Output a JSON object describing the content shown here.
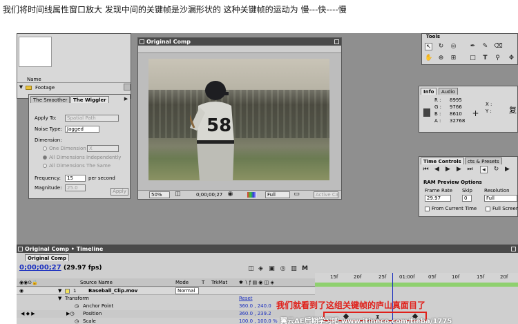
{
  "caption": "我们将时间线属性窗口放大 发现中间的关键帧是沙漏形状的 这种关键帧的运动为 慢---快----慢",
  "project": {
    "col_name": "Name",
    "folder": "Footage"
  },
  "effects": {
    "tab1": "The Smoother",
    "tab2": "The Wiggler",
    "apply_to_label": "Apply To:",
    "apply_to_value": "Spatial Path",
    "noise_label": "Noise Type:",
    "noise_value": "Jagged",
    "dimension_label": "Dimension:",
    "one_dim": "One Dimension",
    "one_dim_value": "X",
    "all_indep": "All Dimensions Independently",
    "all_same": "All Dimensions The Same",
    "freq_label": "Frequency:",
    "freq_value": "15",
    "freq_unit": "per second",
    "mag_label": "Magnitude:",
    "mag_value": "25.0",
    "apply_btn": "Apply"
  },
  "comp": {
    "title": "Original Comp",
    "tab": "Original Comp",
    "zoom": "50%",
    "timecode": "0;00;00;27",
    "quality": "Full",
    "camera": "Active Ca",
    "jersey_number": "58"
  },
  "tools": {
    "title": "Tools"
  },
  "info": {
    "tab_info": "Info",
    "tab_audio": "Audio",
    "r_label": "R :",
    "r_value": "8995",
    "g_label": "G :",
    "g_value": "9766",
    "b_label": "B :",
    "b_value": "8610",
    "a_label": "A :",
    "a_value": "32768",
    "x_label": "X :",
    "y_label": "Y :",
    "overflow": "复"
  },
  "time_controls": {
    "tab1": "Time Controls",
    "tab2": "cts & Presets",
    "ram_title": "RAM Preview Options",
    "frame_rate_label": "Frame Rate",
    "frame_rate_value": "29.97",
    "skip_label": "Skip",
    "skip_value": "0",
    "resolution_label": "Resolution",
    "resolution_value": "Full",
    "from_current": "From Current Time",
    "full_screen": "Full Screen"
  },
  "timeline": {
    "window_title": "Original Comp • Timeline",
    "tab": "Original Comp",
    "timecode": "0;00;00;27",
    "fps": "(29.97 fps)",
    "col_source": "Source Name",
    "col_mode": "Mode",
    "col_t": "T",
    "col_trkmat": "TrkMat",
    "layer_num": "1",
    "layer_name": "Baseball_Clip.mov",
    "mode_value": "Normal",
    "transform": "Transform",
    "reset": "Reset",
    "anchor_label": "Anchor Point",
    "anchor_value": "360.0 , 240.0",
    "position_label": "Position",
    "position_value": "360.0 , 239.2",
    "scale_label": "Scale",
    "scale_value": "100.0 , 100.0 %",
    "ruler": [
      "15f",
      "20f",
      "25f",
      "01:00f",
      "05f",
      "10f",
      "15f",
      "20f"
    ],
    "annotation": "我们就看到了这组关键帧的庐山真面目了",
    "watermark": "翼云AE后期学习吧 www.itineco.com/tieba/1775"
  }
}
